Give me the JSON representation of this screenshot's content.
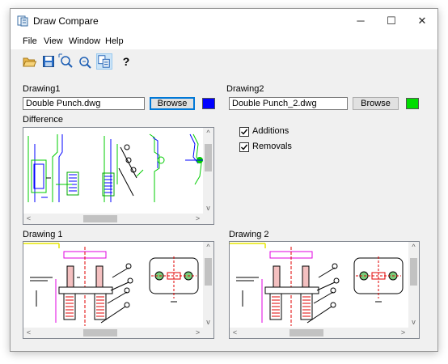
{
  "window": {
    "title": "Draw Compare",
    "controls": {
      "minimize": "─",
      "maximize": "☐",
      "close": "✕"
    }
  },
  "menu": [
    "File",
    "View",
    "Window",
    "Help"
  ],
  "toolbar": {
    "icons": [
      "open-folder-icon",
      "save-icon",
      "zoom-extents-icon",
      "zoom-window-icon",
      "compare-icon",
      "help-icon"
    ],
    "help_label": "?"
  },
  "drawing1": {
    "label": "Drawing1",
    "file": "Double Punch.dwg",
    "browse_label": "Browse",
    "color": "#0000ff"
  },
  "drawing2": {
    "label": "Drawing2",
    "file": "Double Punch_2.dwg",
    "browse_label": "Browse",
    "color": "#00dd00"
  },
  "difference": {
    "label": "Difference"
  },
  "options": {
    "additions": {
      "label": "Additions",
      "checked": true
    },
    "removals": {
      "label": "Removals",
      "checked": true
    }
  },
  "preview1": {
    "label": "Drawing 1"
  },
  "preview2": {
    "label": "Drawing 2"
  },
  "scroll_arrows": {
    "left": "<",
    "right": ">",
    "up": "^",
    "down": "v"
  }
}
